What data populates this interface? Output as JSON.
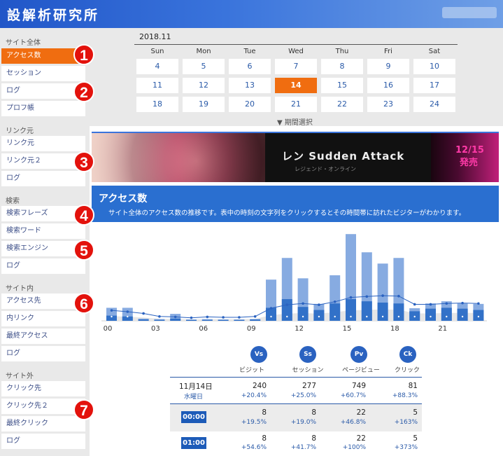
{
  "header": {
    "logo": "設解析研究所"
  },
  "sidebar": {
    "sections": [
      {
        "title": "サイト全体",
        "items": [
          "アクセス数",
          "セッション",
          "ログ",
          "プロフ帳"
        ]
      },
      {
        "title": "リンク元",
        "items": [
          "リンク元",
          "リンク元２",
          "ログ"
        ]
      },
      {
        "title": "検索",
        "items": [
          "検索フレーズ",
          "検索ワード",
          "検索エンジン",
          "ログ"
        ]
      },
      {
        "title": "サイト内",
        "items": [
          "アクセス先",
          "内リンク",
          "最終アクセス",
          "ログ"
        ]
      },
      {
        "title": "サイト外",
        "items": [
          "クリック先",
          "クリック先２",
          "最終クリック",
          "ログ"
        ]
      }
    ],
    "active": "アクセス数"
  },
  "badges": [
    "1",
    "2",
    "3",
    "4",
    "5",
    "6",
    "7"
  ],
  "calendar": {
    "title": "2018.11",
    "weekdays": [
      "Sun",
      "Mon",
      "Tue",
      "Wed",
      "Thu",
      "Fri",
      "Sat"
    ],
    "weeks": [
      [
        "4",
        "5",
        "6",
        "7",
        "8",
        "9",
        "10"
      ],
      [
        "11",
        "12",
        "13",
        "14",
        "15",
        "16",
        "17"
      ],
      [
        "18",
        "19",
        "20",
        "21",
        "22",
        "23",
        "24"
      ]
    ],
    "selected": "14",
    "period_label": "▼ 期間選択"
  },
  "banner": {
    "text": "レン Sudden Attack",
    "sub": "レジェンド・オンライン",
    "date_line1": "12/15",
    "date_line2": "発売"
  },
  "section": {
    "title": "アクセス数",
    "description": "サイト全体のアクセス数の推移です。表中の時刻の文字列をクリックするとその時間帯に訪れたビジターがわかります。"
  },
  "chart_data": {
    "type": "bar",
    "x_tick_labels": [
      "00",
      "03",
      "06",
      "09",
      "12",
      "15",
      "18",
      "21"
    ],
    "hours": [
      0,
      1,
      2,
      3,
      4,
      5,
      6,
      7,
      8,
      9,
      10,
      11,
      12,
      13,
      14,
      15,
      16,
      17,
      18,
      19,
      20,
      21,
      22,
      23
    ],
    "series": [
      {
        "values": [
          30,
          30,
          5,
          4,
          16,
          3,
          4,
          3,
          3,
          4,
          95,
          145,
          98,
          39,
          105,
          200,
          158,
          132,
          145,
          29,
          40,
          45,
          40,
          39
        ]
      },
      {
        "values": [
          12,
          10,
          3,
          2,
          5,
          2,
          2,
          2,
          2,
          3,
          30,
          50,
          32,
          25,
          40,
          50,
          45,
          42,
          40,
          22,
          28,
          30,
          28,
          25
        ]
      },
      {
        "values": [
          24,
          21,
          17,
          10,
          9,
          7,
          9,
          8,
          8,
          10,
          29,
          37,
          40,
          37,
          44,
          54,
          56,
          58,
          57,
          38,
          38,
          40,
          41,
          40
        ]
      }
    ]
  },
  "stats": {
    "icons": [
      "Vs",
      "Ss",
      "Pv",
      "Ck"
    ],
    "labels": [
      "ビジット",
      "セッション",
      "ページビュー",
      "クリック"
    ],
    "rows": [
      {
        "label": "11月14日",
        "sublabel": "水曜日",
        "values": [
          "240",
          "277",
          "749",
          "81"
        ],
        "changes": [
          "+20.4%",
          "+25.0%",
          "+60.7%",
          "+88.3%"
        ]
      },
      {
        "label": "00:00",
        "values": [
          "8",
          "8",
          "22",
          "5"
        ],
        "changes": [
          "+19.5%",
          "+19.0%",
          "+46.8%",
          "+163%"
        ]
      },
      {
        "label": "01:00",
        "values": [
          "8",
          "8",
          "22",
          "5"
        ],
        "changes": [
          "+54.6%",
          "+41.7%",
          "+100%",
          "+373%"
        ]
      }
    ]
  },
  "colors": {
    "accent": "#f06d10",
    "primary": "#2a6fd0",
    "bar_light": "#87abe1",
    "bar_dark": "#3271c8",
    "badge": "#e3120c"
  }
}
